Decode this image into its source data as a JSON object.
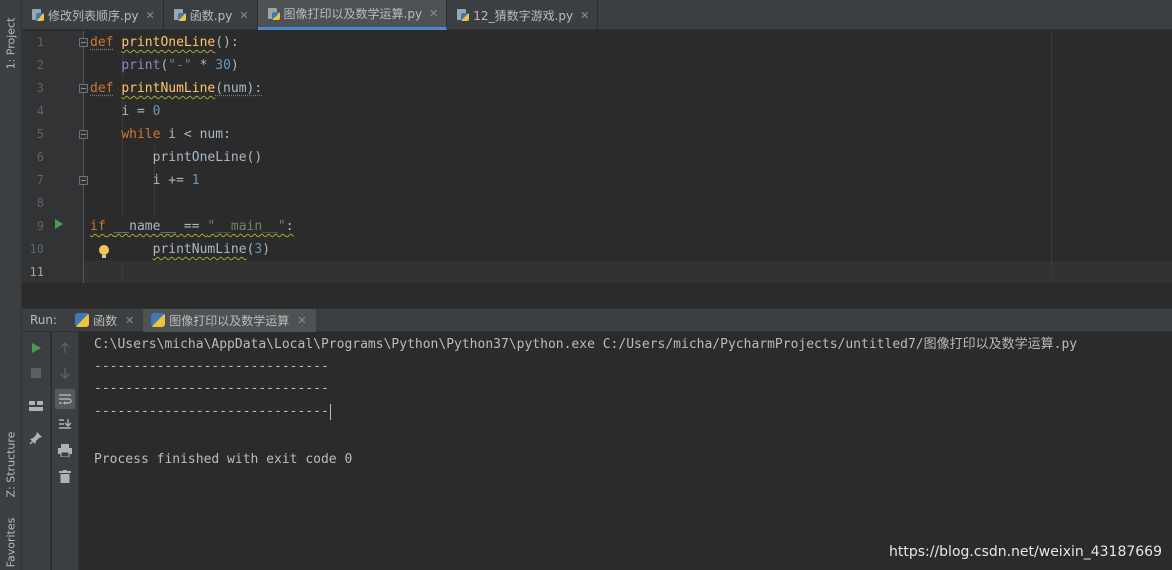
{
  "left_strip": {
    "project_tab": "1: Project",
    "structure_tab": "Z: Structure",
    "favorites_tab": "Favorites"
  },
  "tabs": [
    {
      "label": "修改列表顺序.py",
      "active": false
    },
    {
      "label": "函数.py",
      "active": false
    },
    {
      "label": "图像打印以及数学运算.py",
      "active": true
    },
    {
      "label": "12_猜数字游戏.py",
      "active": false
    }
  ],
  "editor": {
    "line_numbers": [
      "1",
      "2",
      "3",
      "4",
      "5",
      "6",
      "7",
      "8",
      "9",
      "10",
      "11"
    ],
    "lines": {
      "l1": {
        "kw": "def",
        "fn": "printOneLine",
        "rest": "():"
      },
      "l2": {
        "indent": "    ",
        "bi": "print",
        "p1": "(",
        "str": "\"-\"",
        "op": " * ",
        "num": "30",
        "p2": ")"
      },
      "l3": {
        "kw": "def",
        "fn": "printNumLine",
        "rest": "(num):"
      },
      "l4": {
        "indent": "    ",
        "a": "i = ",
        "num": "0"
      },
      "l5": {
        "indent": "    ",
        "kw": "while",
        "rest": " i < num:"
      },
      "l6": {
        "indent": "        ",
        "call": "printOneLine()"
      },
      "l7": {
        "indent": "        ",
        "a": "i += ",
        "num": "1"
      },
      "l9": {
        "kw": "if",
        "sp1": " ",
        "magic": "__name__",
        "op": " == ",
        "str": "\"__main__\"",
        "rest": ":"
      },
      "l10": {
        "indent": "        ",
        "call": "printNumLine",
        "p1": "(",
        "num": "3",
        "p2": ")"
      }
    }
  },
  "run": {
    "label": "Run:",
    "tabs": [
      {
        "label": "函数",
        "active": false
      },
      {
        "label": "图像打印以及数学运算",
        "active": true
      }
    ],
    "console": {
      "command": "C:\\Users\\micha\\AppData\\Local\\Programs\\Python\\Python37\\python.exe C:/Users/micha/PycharmProjects/untitled7/图像打印以及数学运算.py",
      "out1": "------------------------------",
      "out2": "------------------------------",
      "out3": "------------------------------",
      "finished": "Process finished with exit code 0"
    }
  },
  "watermark": "https://blog.csdn.net/weixin_43187669",
  "colors": {
    "keyword": "#cc7832",
    "function": "#ffc66d",
    "builtin": "#8888c6",
    "string": "#6a8759",
    "number": "#6897bb",
    "run_green": "#499c54"
  }
}
